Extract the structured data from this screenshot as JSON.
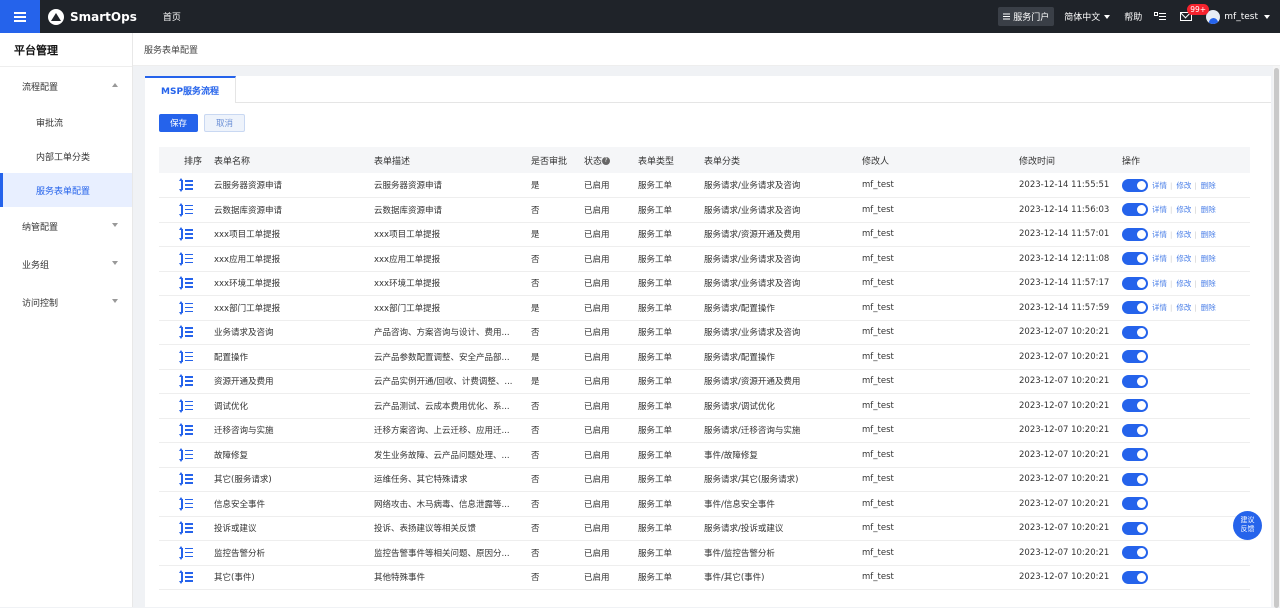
{
  "topbar": {
    "logo": "SmartOps",
    "home": "首页",
    "portal": "服务门户",
    "language": "简体中文",
    "help": "帮助",
    "badge": "99+",
    "user": "mf_test"
  },
  "sidebar": {
    "title": "平台管理",
    "groups": [
      {
        "label": "流程配置"
      },
      {
        "label": "纳管配置"
      },
      {
        "label": "业务组"
      },
      {
        "label": "访问控制"
      }
    ],
    "items": [
      {
        "label": "审批流"
      },
      {
        "label": "内部工单分类"
      },
      {
        "label": "服务表单配置"
      }
    ]
  },
  "breadcrumb": "服务表单配置",
  "tab": "MSP服务流程",
  "buttons": {
    "save": "保存",
    "cancel": "取消"
  },
  "columns": [
    "排序",
    "表单名称",
    "表单描述",
    "是否审批",
    "状态",
    "表单类型",
    "表单分类",
    "修改人",
    "修改时间",
    "操作"
  ],
  "ops": [
    "详情",
    "修改",
    "删除"
  ],
  "rows": [
    {
      "name": "云服务器资源申请",
      "desc": "云服务器资源申请",
      "approve": "是",
      "status": "已启用",
      "type": "服务工单",
      "category": "服务请求/业务请求及咨询",
      "modifier": "mf_test",
      "time": "2023-12-14 11:55:51",
      "enabled": true,
      "ops": true
    },
    {
      "name": "云数据库资源申请",
      "desc": "云数据库资源申请",
      "approve": "否",
      "status": "已启用",
      "type": "服务工单",
      "category": "服务请求/业务请求及咨询",
      "modifier": "mf_test",
      "time": "2023-12-14 11:56:03",
      "enabled": true,
      "ops": true
    },
    {
      "name": "xxx项目工单提报",
      "desc": "xxx项目工单提报",
      "approve": "是",
      "status": "已启用",
      "type": "服务工单",
      "category": "服务请求/资源开通及费用",
      "modifier": "mf_test",
      "time": "2023-12-14 11:57:01",
      "enabled": true,
      "ops": true
    },
    {
      "name": "xxx应用工单提报",
      "desc": "xxx应用工单提报",
      "approve": "否",
      "status": "已启用",
      "type": "服务工单",
      "category": "服务请求/业务请求及咨询",
      "modifier": "mf_test",
      "time": "2023-12-14 12:11:08",
      "enabled": true,
      "ops": true
    },
    {
      "name": "xxx环境工单提报",
      "desc": "xxx环境工单提报",
      "approve": "否",
      "status": "已启用",
      "type": "服务工单",
      "category": "服务请求/业务请求及咨询",
      "modifier": "mf_test",
      "time": "2023-12-14 11:57:17",
      "enabled": true,
      "ops": true
    },
    {
      "name": "xxx部门工单提报",
      "desc": "xxx部门工单提报",
      "approve": "是",
      "status": "已启用",
      "type": "服务工单",
      "category": "服务请求/配置操作",
      "modifier": "mf_test",
      "time": "2023-12-14 11:57:59",
      "enabled": true,
      "ops": true
    },
    {
      "name": "业务请求及咨询",
      "desc": "产品咨询、方案咨询与设计、费用...",
      "approve": "否",
      "status": "已启用",
      "type": "服务工单",
      "category": "服务请求/业务请求及咨询",
      "modifier": "mf_test",
      "time": "2023-12-07 10:20:21",
      "enabled": true,
      "ops": false
    },
    {
      "name": "配置操作",
      "desc": "云产品参数配置调整、安全产品部...",
      "approve": "是",
      "status": "已启用",
      "type": "服务工单",
      "category": "服务请求/配置操作",
      "modifier": "mf_test",
      "time": "2023-12-07 10:20:21",
      "enabled": true,
      "ops": false
    },
    {
      "name": "资源开通及费用",
      "desc": "云产品实例开通/回收、计费调整、...",
      "approve": "是",
      "status": "已启用",
      "type": "服务工单",
      "category": "服务请求/资源开通及费用",
      "modifier": "mf_test",
      "time": "2023-12-07 10:20:21",
      "enabled": true,
      "ops": false
    },
    {
      "name": "调试优化",
      "desc": "云产品测试、云成本费用优化、系...",
      "approve": "否",
      "status": "已启用",
      "type": "服务工单",
      "category": "服务请求/调试优化",
      "modifier": "mf_test",
      "time": "2023-12-07 10:20:21",
      "enabled": true,
      "ops": false
    },
    {
      "name": "迁移咨询与实施",
      "desc": "迁移方案咨询、上云迁移、应用迁...",
      "approve": "否",
      "status": "已启用",
      "type": "服务工单",
      "category": "服务请求/迁移咨询与实施",
      "modifier": "mf_test",
      "time": "2023-12-07 10:20:21",
      "enabled": true,
      "ops": false
    },
    {
      "name": "故障修复",
      "desc": "发生业务故障、云产品问题处理、...",
      "approve": "否",
      "status": "已启用",
      "type": "服务工单",
      "category": "事件/故障修复",
      "modifier": "mf_test",
      "time": "2023-12-07 10:20:21",
      "enabled": true,
      "ops": false
    },
    {
      "name": "其它(服务请求)",
      "desc": "运维任务、其它特殊请求",
      "approve": "否",
      "status": "已启用",
      "type": "服务工单",
      "category": "服务请求/其它(服务请求)",
      "modifier": "mf_test",
      "time": "2023-12-07 10:20:21",
      "enabled": true,
      "ops": false
    },
    {
      "name": "信息安全事件",
      "desc": "网络攻击、木马病毒、信息泄露等...",
      "approve": "否",
      "status": "已启用",
      "type": "服务工单",
      "category": "事件/信息安全事件",
      "modifier": "mf_test",
      "time": "2023-12-07 10:20:21",
      "enabled": true,
      "ops": false
    },
    {
      "name": "投诉或建议",
      "desc": "投诉、表扬建议等相关反馈",
      "approve": "否",
      "status": "已启用",
      "type": "服务工单",
      "category": "服务请求/投诉或建议",
      "modifier": "mf_test",
      "time": "2023-12-07 10:20:21",
      "enabled": true,
      "ops": false
    },
    {
      "name": "监控告警分析",
      "desc": "监控告警事件等相关问题、原因分...",
      "approve": "否",
      "status": "已启用",
      "type": "服务工单",
      "category": "事件/监控告警分析",
      "modifier": "mf_test",
      "time": "2023-12-07 10:20:21",
      "enabled": true,
      "ops": false
    },
    {
      "name": "其它(事件)",
      "desc": "其他特殊事件",
      "approve": "否",
      "status": "已启用",
      "type": "服务工单",
      "category": "事件/其它(事件)",
      "modifier": "mf_test",
      "time": "2023-12-07 10:20:21",
      "enabled": true,
      "ops": false
    }
  ],
  "feedback": {
    "line1": "建议",
    "line2": "反馈"
  }
}
